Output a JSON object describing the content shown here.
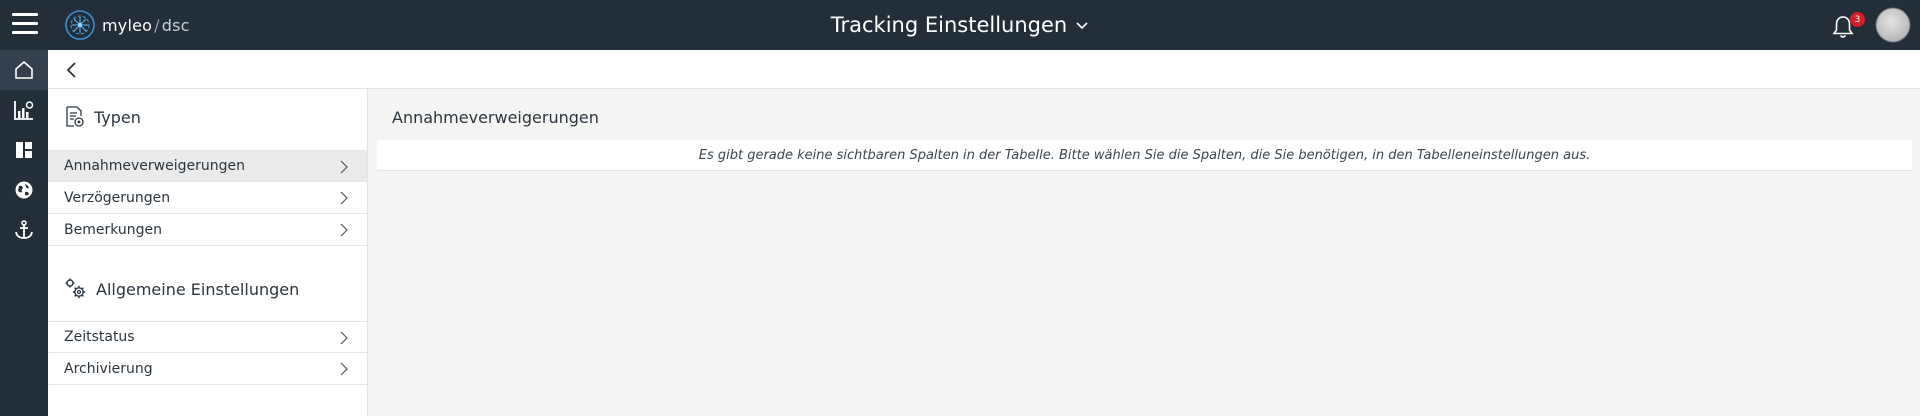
{
  "header": {
    "brand_main": "myleo",
    "brand_slash": "/",
    "brand_sub": "dsc",
    "title": "Tracking Einstellungen",
    "notification_count": "3"
  },
  "rail": {
    "items": [
      "home-icon",
      "chart-icon",
      "dashboard-icon",
      "globe-icon",
      "anchor-icon"
    ]
  },
  "sidebar": {
    "section1_title": "Typen",
    "section1_items": [
      {
        "label": "Annahmeverweigerungen"
      },
      {
        "label": "Verzögerungen"
      },
      {
        "label": "Bemerkungen"
      }
    ],
    "section2_title": "Allgemeine Einstellungen",
    "section2_items": [
      {
        "label": "Zeitstatus"
      },
      {
        "label": "Archivierung"
      }
    ]
  },
  "main": {
    "title": "Annahmeverweigerungen",
    "empty_message": "Es gibt gerade keine sichtbaren Spalten in der Tabelle. Bitte wählen Sie die Spalten, die Sie benötigen, in den Tabelleneinstellungen aus."
  },
  "colors": {
    "topbar": "#232e38",
    "rail_active": "#34404b",
    "badge": "#d0202a",
    "page_bg": "#f5f5f3"
  }
}
